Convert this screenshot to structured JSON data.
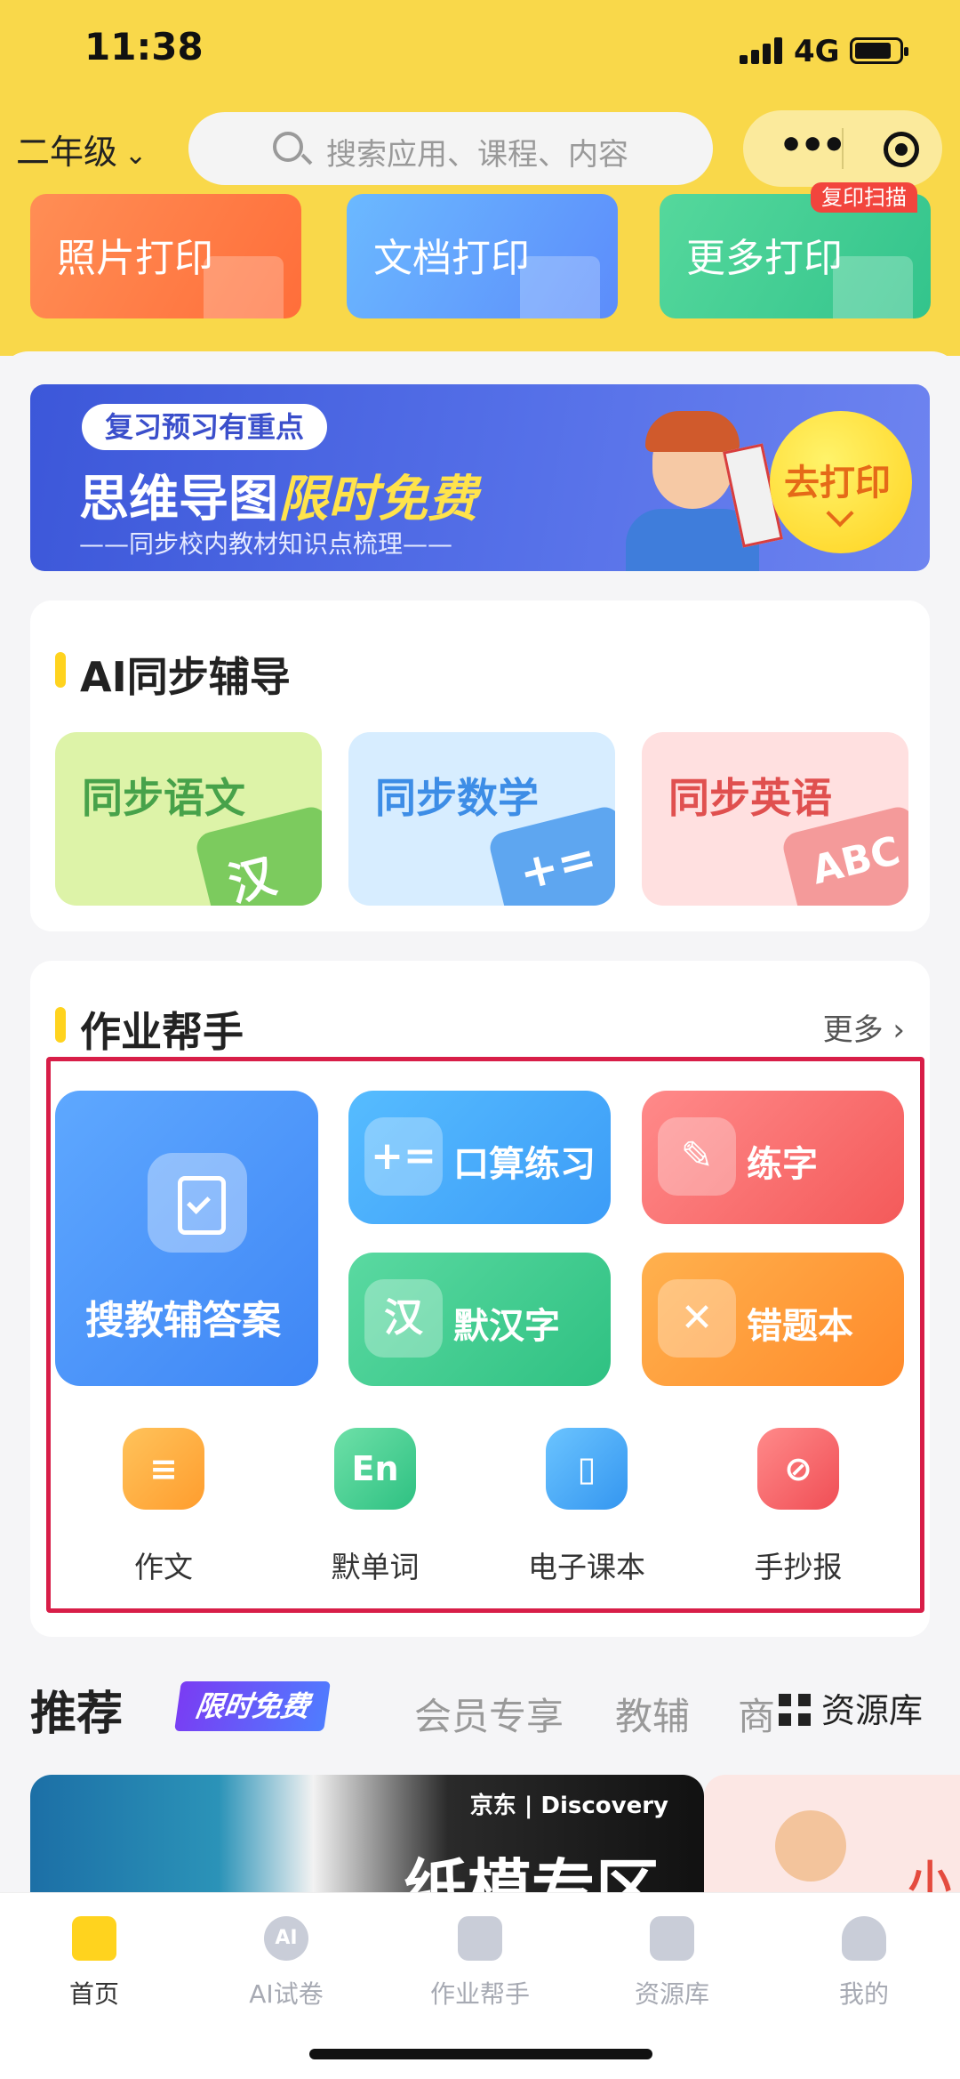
{
  "status_bar": {
    "time": "11:38",
    "network": "4G"
  },
  "header": {
    "grade": "二年级",
    "search_placeholder": "搜索应用、课程、内容",
    "more_label": "•••"
  },
  "print_cards": [
    {
      "label": "照片打印"
    },
    {
      "label": "文档打印"
    },
    {
      "label": "更多打印",
      "badge": "复印扫描"
    }
  ],
  "banner": {
    "tag": "复习预习有重点",
    "title_main": "思维导图",
    "title_highlight": "限时免费",
    "subtitle": "——同步校内教材知识点梳理——",
    "cta": "去打印"
  },
  "ai_section": {
    "title": "AI同步辅导",
    "tiles": [
      {
        "label": "同步语文",
        "glyph": "汉"
      },
      {
        "label": "同步数学",
        "glyph": "+="
      },
      {
        "label": "同步英语",
        "glyph": "ABC"
      }
    ]
  },
  "homework_section": {
    "title": "作业帮手",
    "more": "更多 ›",
    "big_tile": {
      "label": "搜教辅答案",
      "icon": "checklist-icon"
    },
    "tiles": [
      {
        "label": "口算练习",
        "glyph": "+="
      },
      {
        "label": "练字",
        "glyph": "✎"
      },
      {
        "label": "默汉字",
        "glyph": "汉"
      },
      {
        "label": "错题本",
        "glyph": "✕"
      }
    ],
    "mini": [
      {
        "label": "作文",
        "glyph": "≡"
      },
      {
        "label": "默单词",
        "glyph": "En"
      },
      {
        "label": "电子课本",
        "glyph": "▯"
      },
      {
        "label": "手抄报",
        "glyph": "⊘"
      }
    ]
  },
  "recommend": {
    "title": "推荐",
    "badge": "限时免费",
    "tabs": [
      "会员专享",
      "教辅",
      "商"
    ],
    "resource_lib": "资源库",
    "promo_brand": "京东 | Discovery",
    "promo_title": "纸模专区",
    "promo2_char": "小"
  },
  "tabbar": {
    "items": [
      {
        "label": "首页"
      },
      {
        "label": "AI试卷",
        "glyph": "AI"
      },
      {
        "label": "作业帮手"
      },
      {
        "label": "资源库"
      },
      {
        "label": "我的"
      }
    ]
  }
}
